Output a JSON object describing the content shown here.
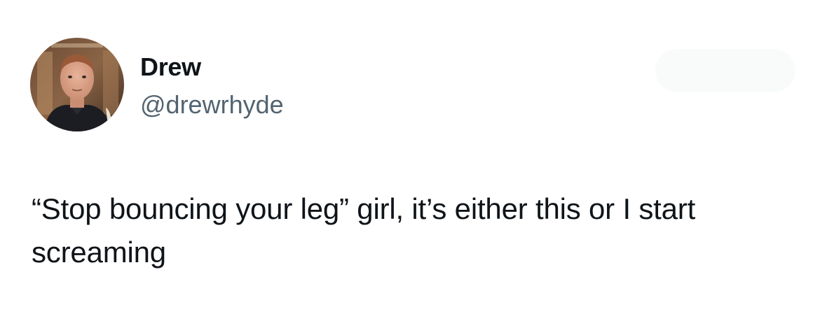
{
  "tweet": {
    "author": {
      "display_name": "Drew",
      "handle": "@drewrhyde",
      "avatar_icon": "profile-photo"
    },
    "text": "“Stop bouncing your leg” girl, it’s either this or I start screaming"
  },
  "colors": {
    "name": "#0f1419",
    "handle": "#536471",
    "background": "#ffffff"
  }
}
